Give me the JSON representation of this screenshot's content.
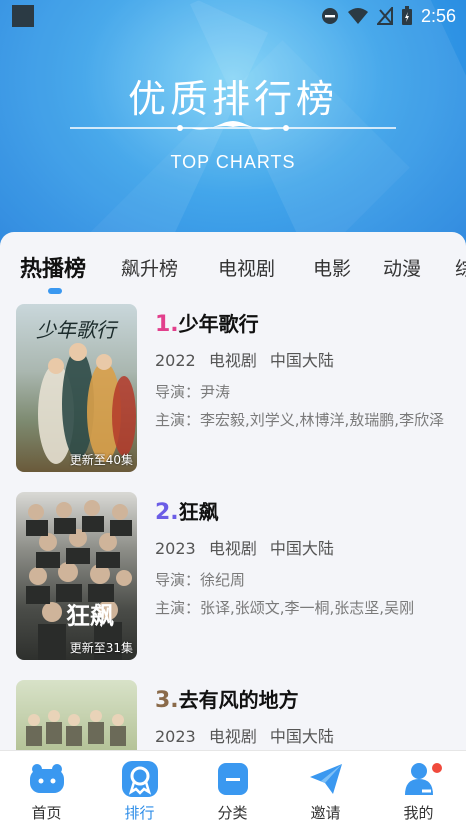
{
  "statusbar": {
    "time": "2:56"
  },
  "banner": {
    "title": "优质排行榜",
    "subtitle": "TOP CHARTS"
  },
  "tabs": [
    {
      "label": "热播榜",
      "active": true
    },
    {
      "label": "飙升榜",
      "active": false
    },
    {
      "label": "电视剧",
      "active": false
    },
    {
      "label": "电影",
      "active": false
    },
    {
      "label": "动漫",
      "active": false
    },
    {
      "label": "综",
      "active": false
    }
  ],
  "items": [
    {
      "rank": "1.",
      "rank_color": "#e23f8c",
      "title": "少年歌行",
      "year": "2022",
      "type": "电视剧",
      "region": "中国大陆",
      "director": "导演：尹涛",
      "cast": "主演：李宏毅,刘学义,林博洋,敖瑞鹏,李欣泽",
      "update": "更新至40集",
      "poster_text": "少年歌行"
    },
    {
      "rank": "2.",
      "rank_color": "#6b5de6",
      "title": "狂飙",
      "year": "2023",
      "type": "电视剧",
      "region": "中国大陆",
      "director": "导演：徐纪周",
      "cast": "主演：张译,张颂文,李一桐,张志坚,吴刚",
      "update": "更新至31集",
      "poster_text": "狂飙"
    },
    {
      "rank": "3.",
      "rank_color": "#8a6a4a",
      "title": "去有风的地方",
      "year": "2023",
      "type": "电视剧",
      "region": "中国大陆",
      "director": "",
      "cast": "",
      "update": "",
      "poster_text": ""
    }
  ],
  "nav": [
    {
      "label": "首页",
      "icon": "home-icon",
      "active": false
    },
    {
      "label": "排行",
      "icon": "ranking-icon",
      "active": true
    },
    {
      "label": "分类",
      "icon": "category-icon",
      "active": false
    },
    {
      "label": "邀请",
      "icon": "invite-icon",
      "active": false
    },
    {
      "label": "我的",
      "icon": "profile-icon",
      "active": false,
      "badge": true
    }
  ],
  "colors": {
    "accent": "#2d8de8",
    "nav_icon": "#3a98f0"
  }
}
